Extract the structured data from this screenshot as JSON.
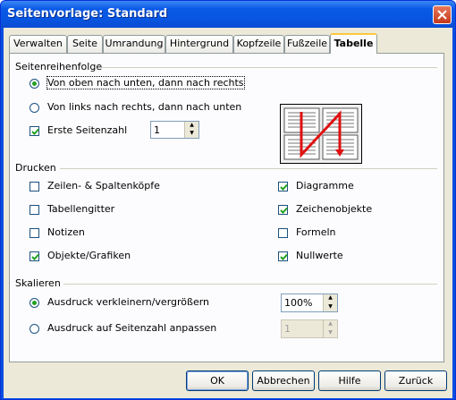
{
  "window": {
    "title": "Seitenvorlage: Standard"
  },
  "tabs": [
    {
      "label": "Verwalten"
    },
    {
      "label": "Seite"
    },
    {
      "label": "Umrandung"
    },
    {
      "label": "Hintergrund"
    },
    {
      "label": "Kopfzeile"
    },
    {
      "label": "Fußzeile"
    },
    {
      "label": "Tabelle",
      "active": true
    }
  ],
  "order": {
    "heading": "Seitenreihenfolge",
    "option1": "Von oben nach unten, dann nach rechts",
    "option2": "Von links nach rechts, dann nach unten",
    "selected": "option1",
    "first_page_label": "Erste Seitenzahl",
    "first_page_checked": true,
    "first_page_value": "1"
  },
  "print": {
    "heading": "Drucken",
    "left": [
      {
        "label": "Zeilen- & Spaltenköpfe",
        "checked": false
      },
      {
        "label": "Tabellengitter",
        "checked": false
      },
      {
        "label": "Notizen",
        "checked": false
      },
      {
        "label": "Objekte/Grafiken",
        "checked": true
      }
    ],
    "right": [
      {
        "label": "Diagramme",
        "checked": true
      },
      {
        "label": "Zeichenobjekte",
        "checked": true
      },
      {
        "label": "Formeln",
        "checked": false
      },
      {
        "label": "Nullwerte",
        "checked": true
      }
    ]
  },
  "scale": {
    "heading": "Skalieren",
    "option1": "Ausdruck verkleinern/vergrößern",
    "option1_value": "100%",
    "option2": "Ausdruck auf Seitenzahl anpassen",
    "option2_value": "1",
    "selected": "option1"
  },
  "buttons": {
    "ok": "OK",
    "cancel": "Abbrechen",
    "help": "Hilfe",
    "back": "Zurück"
  },
  "colors": {
    "title_bar": "#0a5ae6",
    "dialog_bg": "#ece9d8",
    "check_mark": "#21a121",
    "preview_arrow": "#e01010"
  }
}
